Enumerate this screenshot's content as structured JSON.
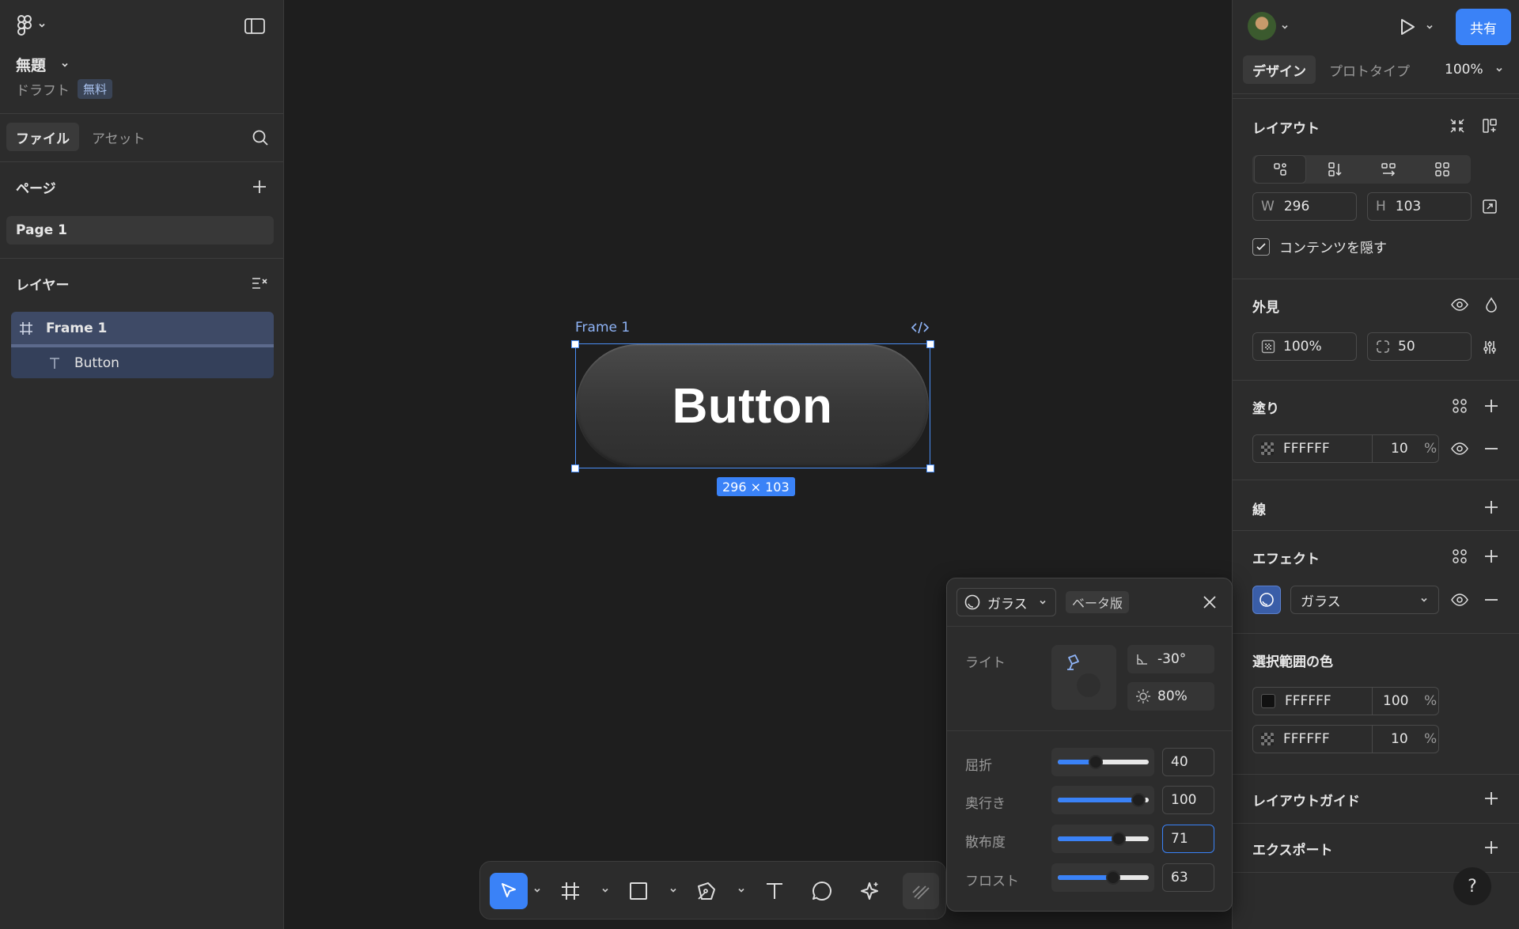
{
  "app": {
    "file_title": "無題",
    "file_status": "ドラフト",
    "plan_badge": "無料"
  },
  "left_panel": {
    "tabs": [
      {
        "label": "ファイル",
        "active": true
      },
      {
        "label": "アセット",
        "active": false
      }
    ],
    "pages_title": "ページ",
    "pages": [
      "Page 1"
    ],
    "layers_title": "レイヤー",
    "layers": [
      {
        "name": "Frame 1",
        "type": "frame-icon"
      },
      {
        "name": "Button",
        "type": "text-icon"
      }
    ]
  },
  "canvas": {
    "frame_label": "Frame 1",
    "button_text": "Button",
    "size_badge": "296 × 103"
  },
  "right_panel": {
    "share_label": "共有",
    "tabs": [
      {
        "label": "デザイン",
        "active": true
      },
      {
        "label": "プロトタイプ",
        "active": false
      }
    ],
    "zoom": "100%",
    "layout": {
      "title": "レイアウト",
      "w_label": "W",
      "w_value": "296",
      "h_label": "H",
      "h_value": "103",
      "clip_label": "コンテンツを隠す",
      "clip_checked": true
    },
    "appearance": {
      "title": "外見",
      "opacity": "100%",
      "radius": "50"
    },
    "fill": {
      "title": "塗り",
      "hex": "FFFFFF",
      "opacity": "10",
      "pct": "%"
    },
    "stroke": {
      "title": "線"
    },
    "effects": {
      "title": "エフェクト",
      "type": "ガラス"
    },
    "selection_colors": {
      "title": "選択範囲の色",
      "colors": [
        {
          "hex": "FFFFFF",
          "opacity": "100",
          "pct": "%",
          "swatch": "#1a1a1a"
        },
        {
          "hex": "FFFFFF",
          "opacity": "10",
          "pct": "%",
          "swatch": "checker"
        }
      ]
    },
    "layout_guide": {
      "title": "レイアウトガイド"
    },
    "export": {
      "title": "エクスポート"
    },
    "help": "?"
  },
  "glass_popover": {
    "type_label": "ガラス",
    "beta_badge": "ベータ版",
    "light_label": "ライト",
    "angle": "-30°",
    "intensity": "80%",
    "params": [
      {
        "label": "屈折",
        "value": "40",
        "fraction": 0.4
      },
      {
        "label": "奥行き",
        "value": "100",
        "fraction": 0.96
      },
      {
        "label": "散布度",
        "value": "71",
        "fraction": 0.7
      },
      {
        "label": "フロスト",
        "value": "63",
        "fraction": 0.63
      }
    ]
  },
  "toolbar": {
    "tools": [
      "move-tool-icon",
      "frame-tool-icon",
      "rectangle-tool-icon",
      "pen-tool-icon",
      "text-tool-icon",
      "comment-tool-icon",
      "ai-tool-icon",
      "draw-mode-icon"
    ],
    "active_tool": "move-tool-icon"
  },
  "colors": {
    "accent": "#3a82f7",
    "panel": "#2c2c2c",
    "canvas": "#1e1e1e"
  }
}
